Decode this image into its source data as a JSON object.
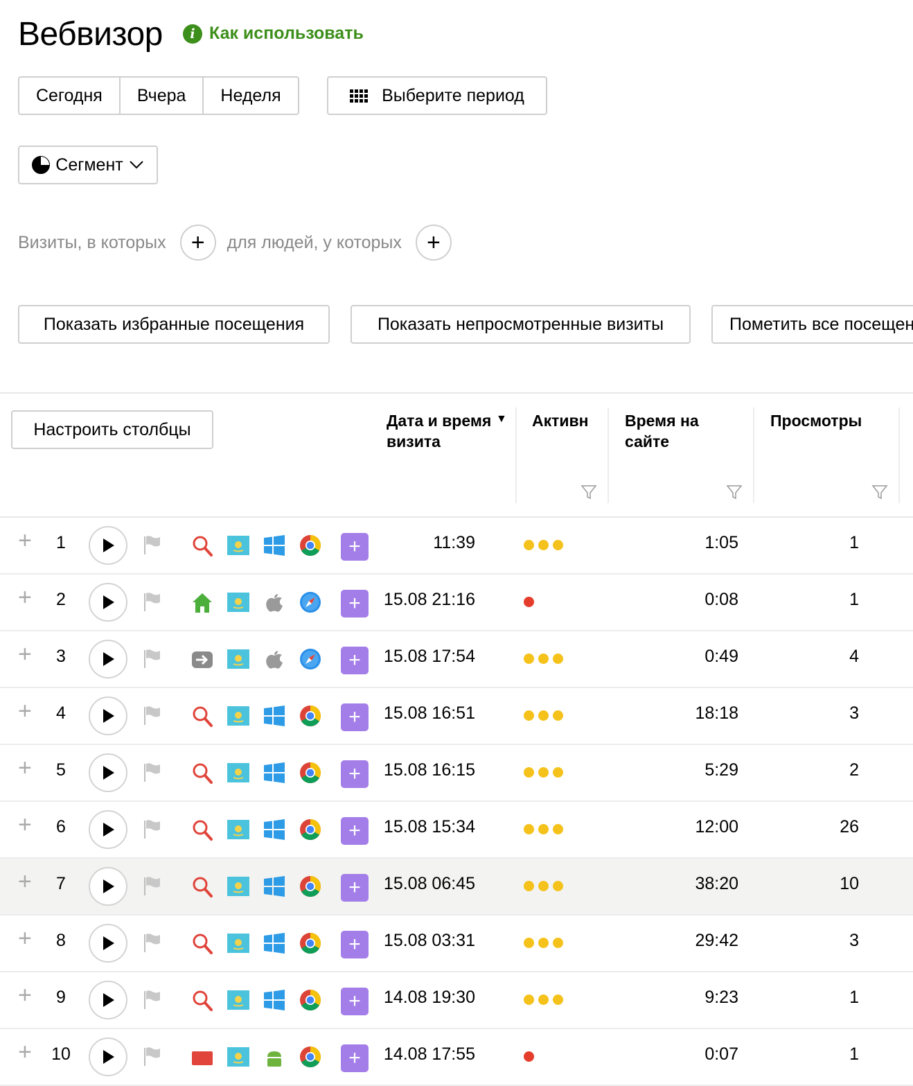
{
  "page": {
    "title": "Вебвизор",
    "help_link": "Как использовать",
    "info_glyph": "i"
  },
  "period": {
    "today": "Сегодня",
    "yesterday": "Вчера",
    "week": "Неделя",
    "choose": "Выберите период"
  },
  "segment": {
    "label": "Сегмент"
  },
  "filters": {
    "visits_label": "Визиты, в которых",
    "people_label": "для людей, у которых",
    "plus": "+"
  },
  "actions": {
    "show_favorites": "Показать избранные посещения",
    "show_unseen": "Показать непросмотренные визиты",
    "mark_all": "Пометить все посещения"
  },
  "table": {
    "configure_columns": "Настроить столбцы",
    "columns": {
      "date": "Дата и время визита",
      "activity": "Активность",
      "time_on_site": "Время на сайте",
      "views": "Просмотры"
    },
    "sort_glyph": "▼",
    "row_add_glyph": "+",
    "row_more_glyph": "+",
    "rows": [
      {
        "num": "1",
        "date": "11:39",
        "activity": 3,
        "activity_color": "#f5c21b",
        "source": "search-icon",
        "os": "windows-icon",
        "browser": "chrome-icon",
        "time": "1:05",
        "views": "1"
      },
      {
        "num": "2",
        "date": "15.08 21:16",
        "activity": 1,
        "activity_color": "#e53d2c",
        "source": "home-icon",
        "os": "apple-icon",
        "browser": "safari-icon",
        "time": "0:08",
        "views": "1"
      },
      {
        "num": "3",
        "date": "15.08 17:54",
        "activity": 3,
        "activity_color": "#f5c21b",
        "source": "link-icon",
        "os": "apple-icon",
        "browser": "safari-icon",
        "time": "0:49",
        "views": "4"
      },
      {
        "num": "4",
        "date": "15.08 16:51",
        "activity": 3,
        "activity_color": "#f5c21b",
        "source": "search-icon",
        "os": "windows-icon",
        "browser": "chrome-icon",
        "time": "18:18",
        "views": "3"
      },
      {
        "num": "5",
        "date": "15.08 16:15",
        "activity": 3,
        "activity_color": "#f5c21b",
        "source": "search-icon",
        "os": "windows-icon",
        "browser": "chrome-icon",
        "time": "5:29",
        "views": "2"
      },
      {
        "num": "6",
        "date": "15.08 15:34",
        "activity": 3,
        "activity_color": "#f5c21b",
        "source": "search-icon",
        "os": "windows-icon",
        "browser": "chrome-icon",
        "time": "12:00",
        "views": "26"
      },
      {
        "num": "7",
        "date": "15.08 06:45",
        "activity": 3,
        "activity_color": "#f5c21b",
        "source": "search-icon",
        "os": "windows-icon",
        "browser": "chrome-icon",
        "time": "38:20",
        "views": "10",
        "highlighted": true
      },
      {
        "num": "8",
        "date": "15.08 03:31",
        "activity": 3,
        "activity_color": "#f5c21b",
        "source": "search-icon",
        "os": "windows-icon",
        "browser": "chrome-icon",
        "time": "29:42",
        "views": "3"
      },
      {
        "num": "9",
        "date": "14.08 19:30",
        "activity": 3,
        "activity_color": "#f5c21b",
        "source": "search-icon",
        "os": "windows-icon",
        "browser": "chrome-icon",
        "time": "9:23",
        "views": "1"
      },
      {
        "num": "10",
        "date": "14.08 17:55",
        "activity": 1,
        "activity_color": "#e53d2c",
        "source": "mail-icon",
        "os": "android-icon",
        "browser": "chrome-icon",
        "time": "0:07",
        "views": "1"
      }
    ]
  }
}
